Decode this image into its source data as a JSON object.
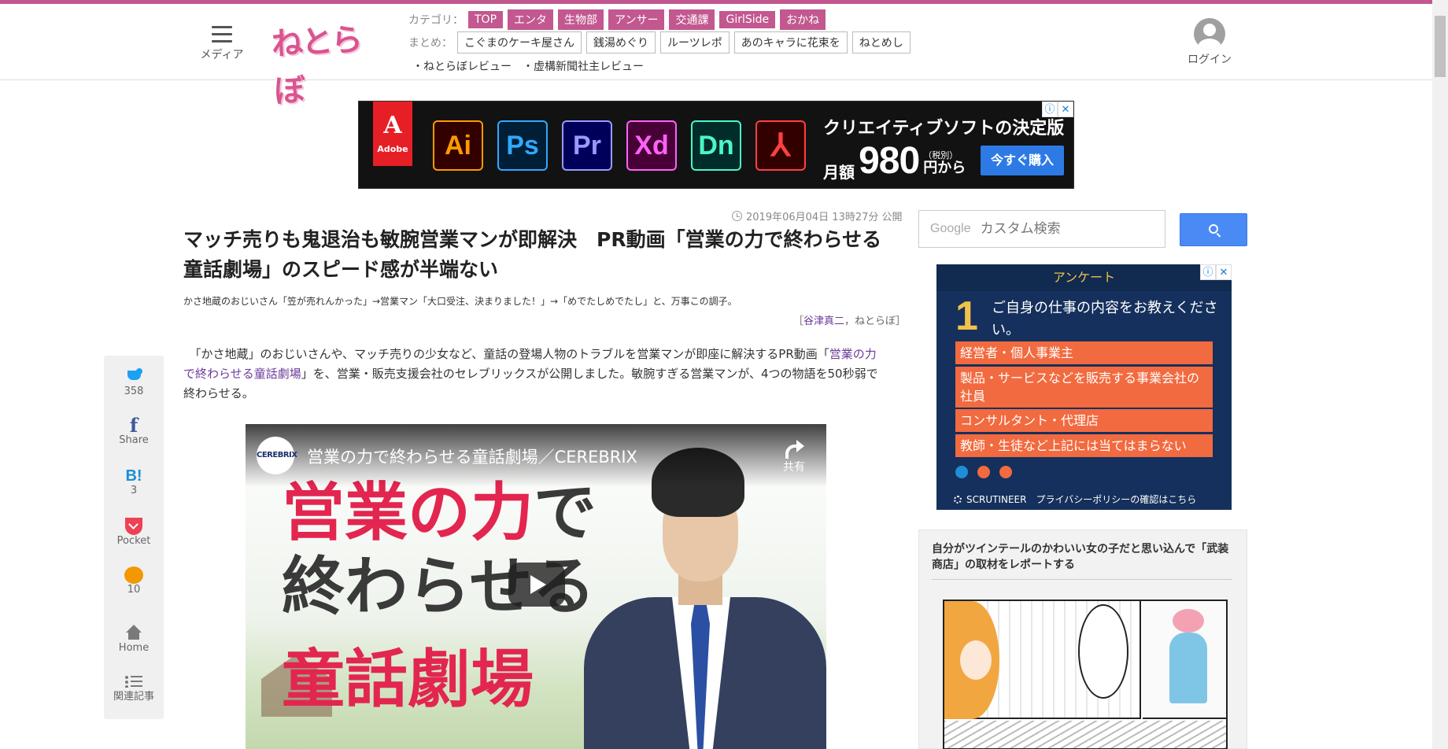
{
  "header": {
    "menu_label": "メディア",
    "logo_text": "ねとらぼ",
    "category_label": "カテゴリ：",
    "categories": [
      "TOP",
      "エンタ",
      "生物部",
      "アンサー",
      "交通課",
      "GirlSide",
      "おかね"
    ],
    "matome_label": "まとめ：",
    "matome": [
      "こぐまのケーキ屋さん",
      "銭湯めぐり",
      "ルーツレポ",
      "あのキャラに花束を",
      "ねとめし"
    ],
    "reviews": [
      "・ねとらぼレビュー",
      "・虚構新聞社主レビュー"
    ],
    "login_label": "ログイン"
  },
  "ad_banner": {
    "brand": "Adobe",
    "brand_glyph": "A",
    "apps": [
      {
        "name": "Ai",
        "color": "#ff9a00",
        "bg": "#330000"
      },
      {
        "name": "Ps",
        "color": "#31a8ff",
        "bg": "#001e36"
      },
      {
        "name": "Pr",
        "color": "#9999ff",
        "bg": "#00005b"
      },
      {
        "name": "Xd",
        "color": "#ff61f6",
        "bg": "#470137"
      },
      {
        "name": "Dn",
        "color": "#4af7c6",
        "bg": "#002d2a"
      },
      {
        "name": "acrobat-icon",
        "color": "#ff4040",
        "bg": "#330000"
      }
    ],
    "headline": "クリエイティブソフトの決定版",
    "price_prefix": "月額",
    "price": "980",
    "price_tax": "（税別）",
    "price_suffix": "円から",
    "buy_label": "今すぐ購入",
    "adchoice_info": "ⓘ",
    "adchoice_close": "✕"
  },
  "article": {
    "published": "2019年06月04日 13時27分 公開",
    "title": "マッチ売りも鬼退治も敏腕営業マンが即解決　PR動画「営業の力で終わらせる童話劇場」のスピード感が半端ない",
    "subtitle": "かさ地蔵のおじいさん「笠が売れんかった」→営業マン「大口受注、決まりました！」→「めでたしめでたし」と、万事この調子。",
    "byline_open": "［",
    "author": "谷津真二",
    "byline_site": "，ねとらぼ］",
    "lead_before": "　「かさ地蔵」のおじいさんや、マッチ売りの少女など、童話の登場人物のトラブルを営業マンが即座に解決するPR動画「",
    "lead_link": "営業の力で終わらせる童話劇場",
    "lead_after": "」を、営業・販売支援会社のセレブリックスが公開しました。敏腕すぎる営業マンが、4つの物語を50秒弱で終わらせる。"
  },
  "share": {
    "twitter_count": "358",
    "facebook_glyph": "f",
    "facebook_label": "Share",
    "hatena_glyph": "B!",
    "hatena_count": "3",
    "pocket_label": "Pocket",
    "comment_count": "10",
    "home_label": "Home",
    "related_label": "関連記事"
  },
  "video": {
    "channel_name": "CEREBRIX",
    "title": "営業の力で終わらせる童話劇場／CEREBRIX",
    "share_label": "共有",
    "thumb_line1_red": "営業の力",
    "thumb_line1_dark": "で",
    "thumb_line2": "終わらせる",
    "thumb_line3": "童話劇場"
  },
  "sidebar": {
    "search_brand": "Google",
    "search_placeholder": "カスタム検索",
    "survey": {
      "header": "アンケート",
      "info": "ⓘ",
      "close": "✕",
      "number": "1",
      "question": "ご自身の仕事の内容をお教えください。",
      "options": [
        "経営者・個人事業主",
        "製品・サービスなどを販売する事業会社の社員",
        "コンサルタント・代理店",
        "教師・生徒など上記には当てはまらない"
      ],
      "footer_brand": "SCRUTINEER",
      "footer_link": "プライバシーポリシーの確認はこちら"
    },
    "related": {
      "title": "自分がツインテールのかわいい女の子だと思い込んで「武装商店」の取材をレポートする"
    }
  }
}
